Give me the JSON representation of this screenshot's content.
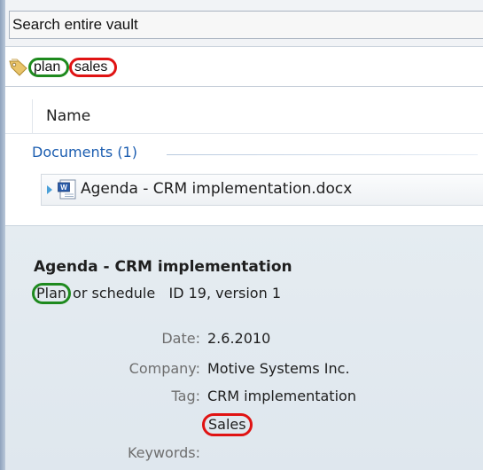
{
  "search": {
    "placeholder": "Search entire vault"
  },
  "filter": {
    "tags": [
      "plan",
      "sales"
    ],
    "icon": "tag-icon"
  },
  "list": {
    "column_name": "Name",
    "group_label": "Documents (1)",
    "items": [
      {
        "name": "Agenda - CRM implementation.docx",
        "icon": "word-document-icon"
      }
    ]
  },
  "details": {
    "title": "Agenda - CRM implementation",
    "class_highlight": "Plan",
    "class_rest": "or schedule",
    "id_version": "ID 19, version 1",
    "properties": [
      {
        "label": "Date:",
        "value": "2.6.2010"
      },
      {
        "label": "Company:",
        "value": "Motive Systems Inc."
      },
      {
        "label": "Tag:",
        "value": "CRM implementation"
      },
      {
        "label": "",
        "value": "Sales"
      },
      {
        "label": "Keywords:",
        "value": ""
      }
    ]
  },
  "colors": {
    "highlight_green": "#1e8a1e",
    "highlight_red": "#e01313",
    "group_blue": "#1b5db0"
  }
}
